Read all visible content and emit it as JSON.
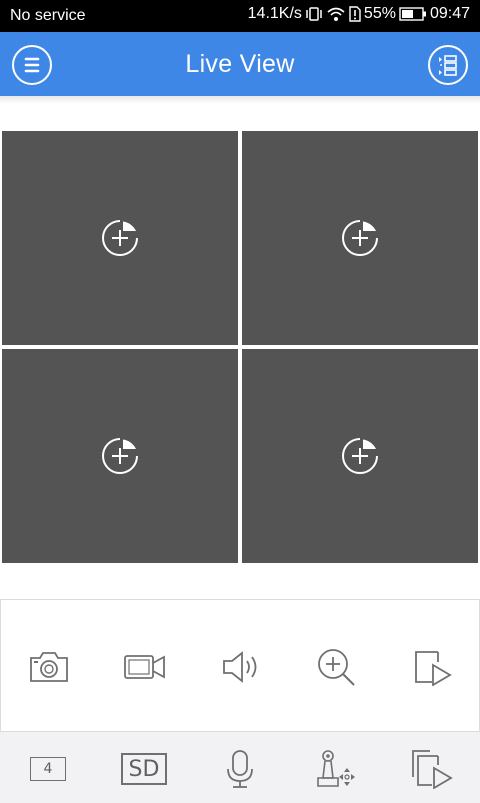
{
  "status_bar": {
    "carrier": "No service",
    "speed": "14.1K/s",
    "battery": "55%",
    "time": "09:47"
  },
  "header": {
    "title": "Live View",
    "menu_icon": "menu-icon",
    "layout_icon": "window-layout-icon"
  },
  "grid": {
    "cells": [
      {
        "icon": "add-camera-icon"
      },
      {
        "icon": "add-camera-icon"
      },
      {
        "icon": "add-camera-icon"
      },
      {
        "icon": "add-camera-icon"
      }
    ]
  },
  "toolbar": {
    "items": [
      "camera-icon",
      "video-record-icon",
      "speaker-icon",
      "zoom-in-icon",
      "playback-icon"
    ]
  },
  "bottom_bar": {
    "window_count": "4",
    "quality": "SD",
    "items": [
      "window-count",
      "stream-quality",
      "microphone-icon",
      "ptz-icon",
      "multi-playback-icon"
    ]
  },
  "colors": {
    "header": "#3f87e6",
    "cell": "#545454",
    "icon_gray": "#707070"
  }
}
